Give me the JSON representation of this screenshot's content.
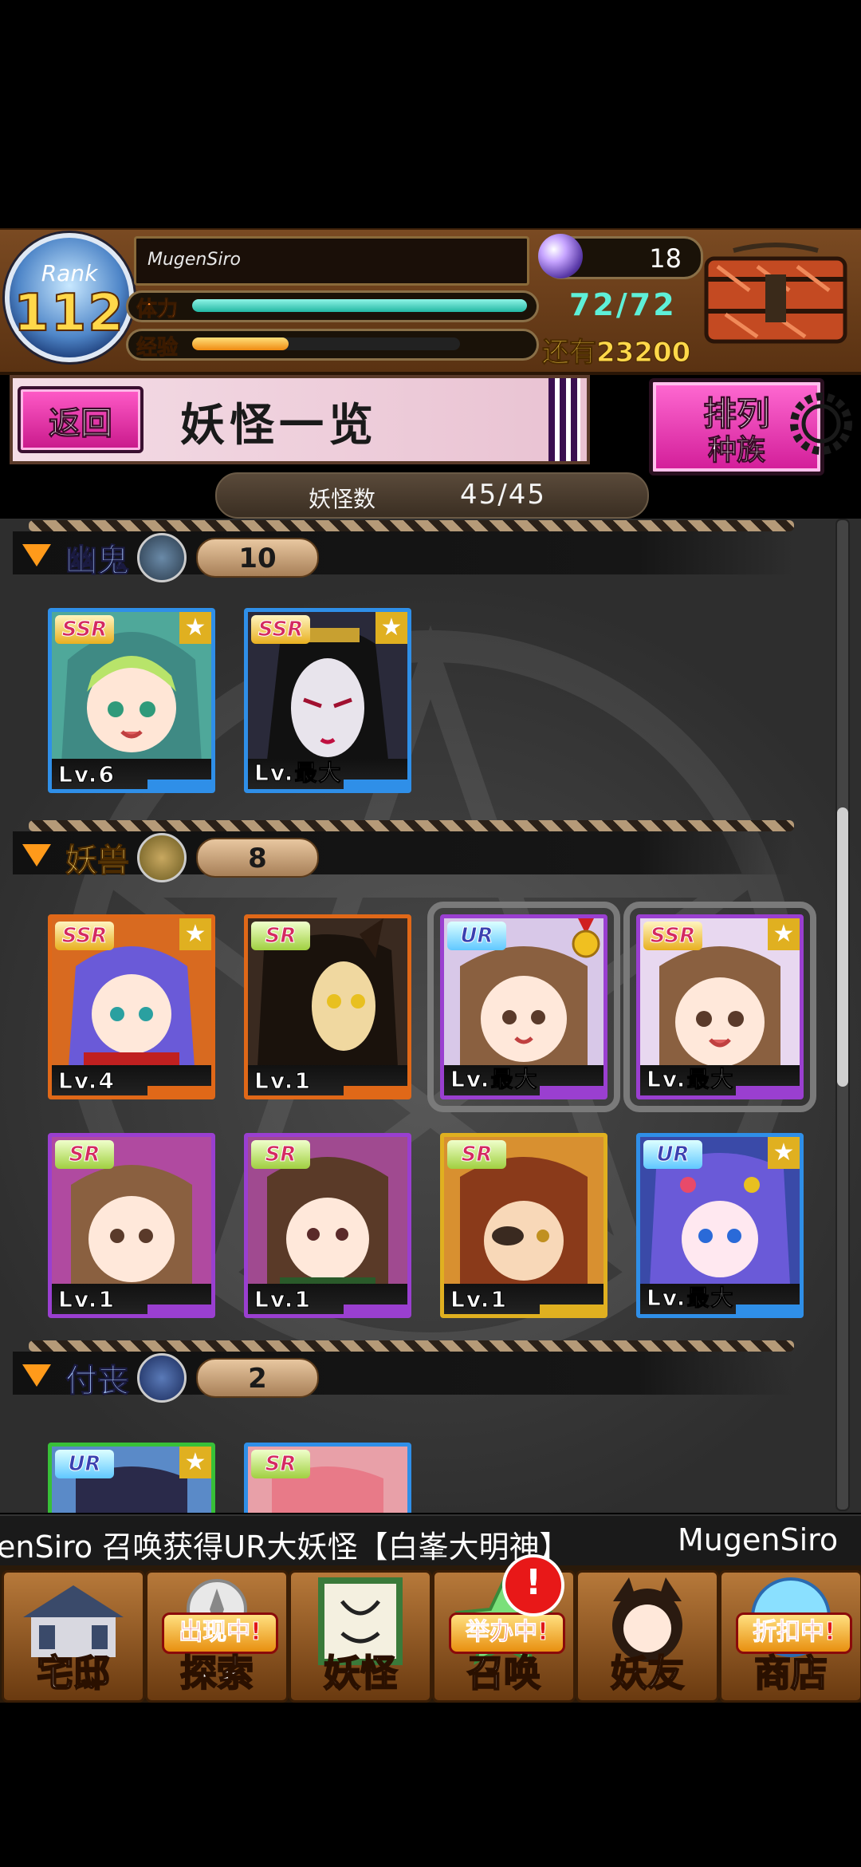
{
  "header": {
    "rank_label": "Rank",
    "rank_value": "112",
    "player_name": "MugenSiro",
    "stamina_label": "体力",
    "stamina_value": "72/72",
    "stamina_fraction": 1.0,
    "exp_label": "经验",
    "exp_fraction": 0.36,
    "exp_remaining": "还有23200",
    "orb_count": "18",
    "chest_icon": "treasure-chest-icon"
  },
  "title_bar": {
    "back_label": "返回",
    "title": "妖怪一览",
    "sort_label_top": "排列",
    "sort_label_bottom": "种族"
  },
  "count": {
    "label": "妖怪数",
    "value": "45/45"
  },
  "groups": [
    {
      "name": "幽鬼",
      "count": "10",
      "cards": [
        {
          "rarity": "SSR",
          "level": "Lv.6"
        },
        {
          "rarity": "SSR",
          "level": "Lv.最大"
        }
      ]
    },
    {
      "name": "妖兽",
      "count": "8",
      "cards": [
        {
          "rarity": "SSR",
          "level": "Lv.4"
        },
        {
          "rarity": "SR",
          "level": "Lv.1"
        },
        {
          "rarity": "UR",
          "level": "Lv.最大"
        },
        {
          "rarity": "SSR",
          "level": "Lv.最大"
        },
        {
          "rarity": "SR",
          "level": "Lv.1"
        },
        {
          "rarity": "SR",
          "level": "Lv.1"
        },
        {
          "rarity": "SR",
          "level": "Lv.1"
        },
        {
          "rarity": "UR",
          "level": "Lv.最大"
        }
      ]
    },
    {
      "name": "付丧",
      "count": "2",
      "cards": [
        {
          "rarity": "UR",
          "level": ""
        },
        {
          "rarity": "SR",
          "level": ""
        }
      ]
    }
  ],
  "ticker": {
    "text": "enSiro 召唤获得UR大妖怪【白峯大明神】",
    "text2": "MugenSiro"
  },
  "nav": [
    {
      "label": "宅邸",
      "badge": ""
    },
    {
      "label": "探索",
      "badge": "出现中!"
    },
    {
      "label": "妖怪",
      "badge": ""
    },
    {
      "label": "召唤",
      "badge": "举办中!"
    },
    {
      "label": "妖友",
      "badge": ""
    },
    {
      "label": "商店",
      "badge": "折扣中!"
    }
  ],
  "notify": "!",
  "colors": {
    "accent_pink": "#e0289e",
    "stamina": "#22b8a4",
    "exp": "#f08a10",
    "header_bg": "#6a3c18"
  }
}
